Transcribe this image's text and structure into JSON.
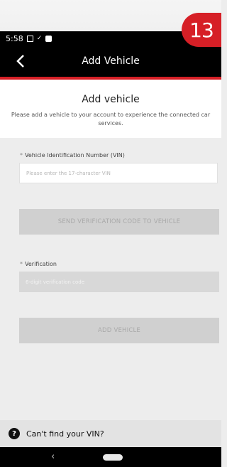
{
  "step_badge": "13",
  "status_bar": {
    "time": "5:58"
  },
  "app_bar": {
    "title": "Add Vehicle"
  },
  "content": {
    "title": "Add vehicle",
    "description": "Please add a vehicle to your account to experience the connected car\nservices."
  },
  "vin_field": {
    "required_mark": "*",
    "label": "Vehicle Identification Number (VIN)",
    "placeholder": "Please enter the 17-character VIN",
    "value": ""
  },
  "send_code_button": {
    "label": "SEND VERIFICATION CODE TO VEHICLE",
    "enabled": false
  },
  "verification_field": {
    "required_mark": "*",
    "label": "Verification",
    "placeholder": "6-digit verification code",
    "value": ""
  },
  "add_vehicle_button": {
    "label": "ADD VEHICLE",
    "enabled": false
  },
  "help": {
    "icon": "?",
    "text": "Can't find your VIN?"
  },
  "nav": {
    "back_glyph": "‹"
  },
  "colors": {
    "brand": "#d61f26",
    "bar": "#000000",
    "disabled_button": "#d0d0d0"
  },
  "icons": [
    "back-arrow-icon",
    "help-icon",
    "nav-back-icon",
    "nav-home-pill"
  ]
}
